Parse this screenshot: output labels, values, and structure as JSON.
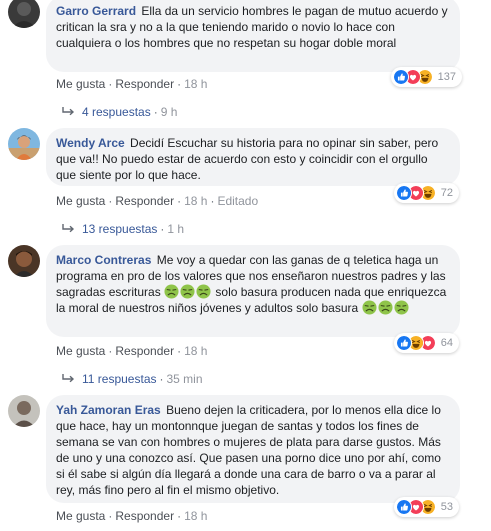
{
  "comments": [
    {
      "author": "Garro Gerrard",
      "text": "Ella da un servicio hombres le pagan de mutuo acuerdo y critican la sra y no a la que teniendo marido o novio lo hace con cualquiera o los hombres que no respetan su hogar doble moral",
      "like": "Me gusta",
      "reply": "Responder",
      "time": "18 h",
      "reaction_count": "137",
      "replies_label": "4 respuestas",
      "replies_time": "9 h"
    },
    {
      "author": "Wendy Arce",
      "text": "Decidí Escuchar su historia para no opinar sin saber, pero que va!! No puedo estar de acuerdo con esto y coincidir con el orgullo que siente por lo que hace.",
      "like": "Me gusta",
      "reply": "Responder",
      "time": "18 h",
      "edited": "Editado",
      "reaction_count": "72",
      "replies_label": "13 respuestas",
      "replies_time": "1 h"
    },
    {
      "author": "Marco Contreras",
      "text_a": "Me voy a quedar con las ganas de q teletica haga un programa en pro de los valores que nos enseñaron nuestros padres y las sagradas escrituras",
      "text_b": "solo basura producen nada que enriquezca la moral de nuestros niños jóvenes y adultos solo basura",
      "like": "Me gusta",
      "reply": "Responder",
      "time": "18 h",
      "reaction_count": "64",
      "replies_label": "11 respuestas",
      "replies_time": "35 min"
    },
    {
      "author": "Yah Zamoran Eras",
      "text": "Bueno dejen la criticadera, por lo menos ella dice lo que hace, hay un montonnque juegan de santas y todos los fines de semana se van con hombres o mujeres de plata para darse gustos. Más de uno y una conozco así. Que pasen una porno dice uno por ahí, como si él sabe si algún día llegará a donde una cara de barro o va a parar al rey, más fino pero al fin el mismo objetivo.",
      "like": "Me gusta",
      "reply": "Responder",
      "time": "18 h",
      "reaction_count": "53"
    }
  ],
  "colors": {
    "author": "#385898",
    "bubble": "#f2f3f5",
    "meta": "#606770",
    "like_blue": "#1877f2",
    "love_red": "#f33e58",
    "haha_yellow": "#f7b125"
  },
  "icons": [
    "like-reaction-icon",
    "love-reaction-icon",
    "haha-reaction-icon",
    "sick-face-emoji",
    "reply-arrow-icon"
  ]
}
